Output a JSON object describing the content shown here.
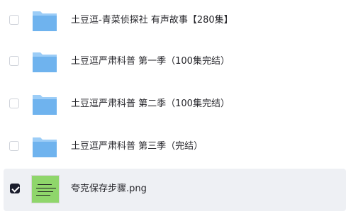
{
  "files": [
    {
      "name": "土豆逗-青菜侦探社 有声故事【280集】",
      "type": "folder",
      "selected": false
    },
    {
      "name": "土豆逗严肃科普 第一季（100集完结）",
      "type": "folder",
      "selected": false
    },
    {
      "name": "土豆逗严肃科普 第二季（100集完结）",
      "type": "folder",
      "selected": false
    },
    {
      "name": "土豆逗严肃科普 第三季（完结）",
      "type": "folder",
      "selected": false
    },
    {
      "name": "夸克保存步骤.png",
      "type": "image",
      "selected": true
    }
  ],
  "colors": {
    "folder_front": "#6fb3ee",
    "folder_back": "#9ccdf7",
    "selected_row_bg": "#eef0f4",
    "checkbox_checked": "#1a1d2c",
    "thumbnail": "#8fd66b"
  },
  "icons": {
    "folder": "folder-icon",
    "image": "image-thumbnail-icon"
  }
}
